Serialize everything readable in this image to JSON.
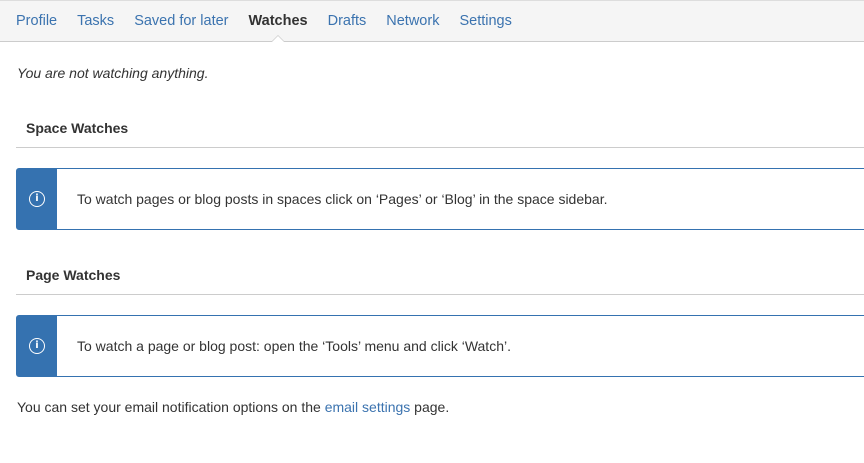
{
  "tabs": [
    {
      "label": "Profile",
      "active": false
    },
    {
      "label": "Tasks",
      "active": false
    },
    {
      "label": "Saved for later",
      "active": false
    },
    {
      "label": "Watches",
      "active": true
    },
    {
      "label": "Drafts",
      "active": false
    },
    {
      "label": "Network",
      "active": false
    },
    {
      "label": "Settings",
      "active": false
    }
  ],
  "empty_message": "You are not watching anything.",
  "space_watches": {
    "heading": "Space Watches",
    "info_icon": "info-icon",
    "info_text": "To watch pages or blog posts in spaces click on ‘Pages’ or ‘Blog’ in the space sidebar."
  },
  "page_watches": {
    "heading": "Page Watches",
    "info_icon": "info-icon",
    "info_text": "To watch a page or blog post: open the ‘Tools’ menu and click ‘Watch’."
  },
  "footer": {
    "prefix": "You can set your email notification options on the ",
    "link_text": "email settings",
    "suffix": " page."
  },
  "colors": {
    "link": "#3b73af",
    "info_accent": "#3572b0"
  }
}
